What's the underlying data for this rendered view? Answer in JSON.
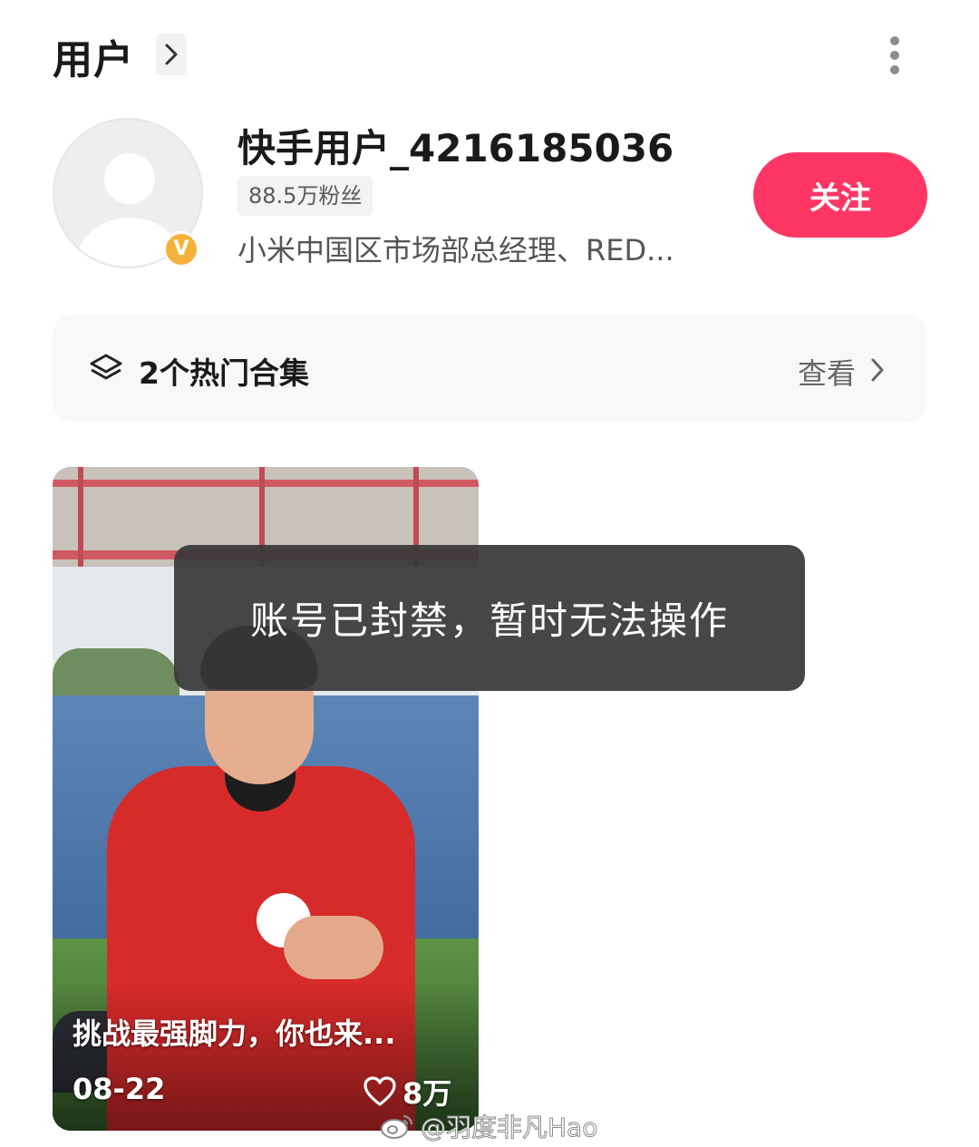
{
  "header": {
    "title": "用户"
  },
  "user": {
    "name": "快手用户_4216185036",
    "fans": "88.5万粉丝",
    "bio": "小米中国区市场部总经理、RED...",
    "verified_badge": "V",
    "follow_label": "关注"
  },
  "collection": {
    "label": "2个热门合集",
    "view_label": "查看"
  },
  "video": {
    "caption": "挑战最强脚力，你也来...",
    "date": "08-22",
    "likes": "8万"
  },
  "toast": {
    "message": "账号已封禁，暂时无法操作"
  },
  "watermark": {
    "text": "@羽度非凡Hao"
  },
  "colors": {
    "accent": "#fe3666",
    "badge": "#f4b23a",
    "toast_bg": "#373737"
  }
}
